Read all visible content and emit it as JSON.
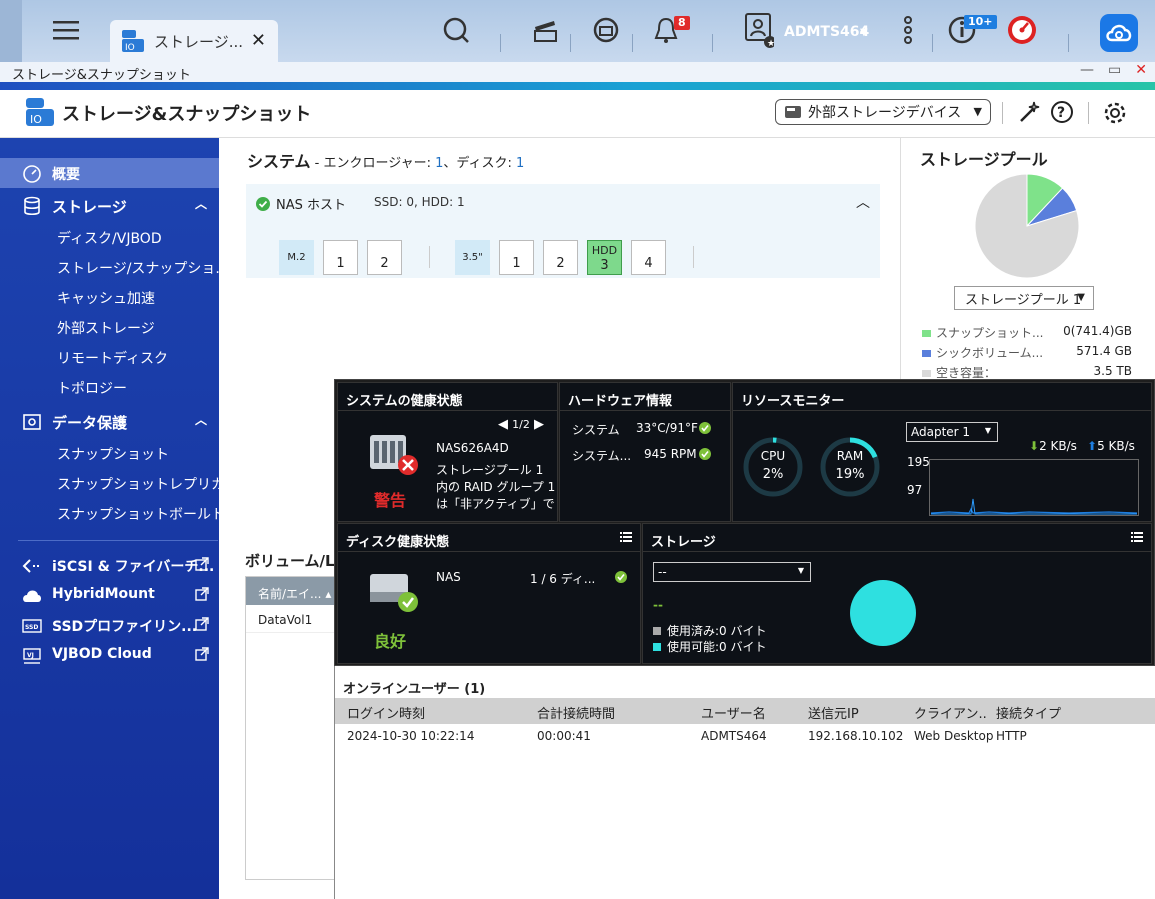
{
  "topbar": {
    "app_tab_title": "ストレージ...",
    "notification_count": "8",
    "user": "ADMTS464",
    "updates_count": "10+"
  },
  "window": {
    "title": "ストレージ&スナップショット"
  },
  "header": {
    "title": "ストレージ&スナップショット",
    "external_storage_select": "外部ストレージデバイス"
  },
  "sidebar": {
    "overview": "概要",
    "storage": "ストレージ",
    "storage_items": [
      "ディスク/VJBOD",
      "ストレージ/スナップショ...",
      "キャッシュ加速",
      "外部ストレージ",
      "リモートディスク",
      "トポロジー"
    ],
    "data_protection": "データ保護",
    "protection_items": [
      "スナップショット",
      "スナップショットレプリカ",
      "スナップショットボールト"
    ],
    "bottom_items": [
      "iSCSI & ファイバーチ...",
      "HybridMount",
      "SSDプロファイリン...",
      "VJBOD Cloud"
    ]
  },
  "system": {
    "title": "システム",
    "subtitle": " - エンクロージャー: ",
    "enclosure_count": "1",
    "disk_label": "、ディスク: ",
    "disk_count": "1",
    "nas_host": "NAS ホスト",
    "drive_summary": "SSD: 0, HDD: 1",
    "m2_label": "M.2",
    "m2_slots": [
      "1",
      "2"
    ],
    "bay_label": "3.5\"",
    "bay_slots": [
      "1",
      "2",
      "3",
      "4"
    ],
    "hdd_tag": "HDD"
  },
  "storage_pool": {
    "title": "ストレージプール",
    "selected": "ストレージプール 1",
    "legend": [
      {
        "label": "スナップショット...",
        "value": "0(741.4)GB",
        "color": "#7fe28a"
      },
      {
        "label": "シックボリューム...",
        "value": "571.4 GB",
        "color": "#5a7fdc"
      },
      {
        "label": "空き容量：",
        "value": "3.5 TB",
        "color": "#d9d9d9"
      }
    ],
    "pie_fractions": [
      0.12,
      0.082,
      0.798
    ]
  },
  "volumes": {
    "title": "ボリューム/L",
    "col_name": "名前/エイ...",
    "row": "DataVol1"
  },
  "health": {
    "title": "システムの健康状態",
    "page": "1/2",
    "status": "警告",
    "device": "NAS626A4D",
    "message": "ストレージプール 1 内の RAID グループ 1 は「非アクティブ」で"
  },
  "hardware": {
    "title": "ハードウェア情報",
    "rows": [
      {
        "label": "システム",
        "value": "33°C/91°F"
      },
      {
        "label": "システム...",
        "value": "945 RPM"
      }
    ]
  },
  "resource": {
    "title": "リソースモニター",
    "cpu_label": "CPU",
    "cpu_value": "2%",
    "cpu_pct": 0.02,
    "ram_label": "RAM",
    "ram_value": "19%",
    "ram_pct": 0.19,
    "adapter": "Adapter 1",
    "down": "2 KB/s",
    "up": "5 KB/s",
    "y_high": "195",
    "y_low": "97"
  },
  "disk_health": {
    "title": "ディスク健康状態",
    "status": "良好",
    "name": "NAS",
    "count": "1 / 6 ディ..."
  },
  "storage_panel": {
    "title": "ストレージ",
    "select": "--",
    "dash": "--",
    "used": "使用済み:0 バイト",
    "avail": "使用可能:0 バイト"
  },
  "online": {
    "title": "オンラインユーザー (1)",
    "columns": [
      "ログイン時刻",
      "合計接続時間",
      "ユーザー名",
      "送信元IP",
      "クライアン...",
      "接続タイプ"
    ],
    "rows": [
      [
        "2024-10-30 10:22:14",
        "00:00:41",
        "ADMTS464",
        "192.168.10.102",
        "Web Desktop",
        "HTTP"
      ]
    ]
  },
  "colors": {
    "accent": "#1d43b0",
    "warn": "#e02b2b",
    "good": "#7ec13a",
    "teal": "#2ee0e0"
  }
}
